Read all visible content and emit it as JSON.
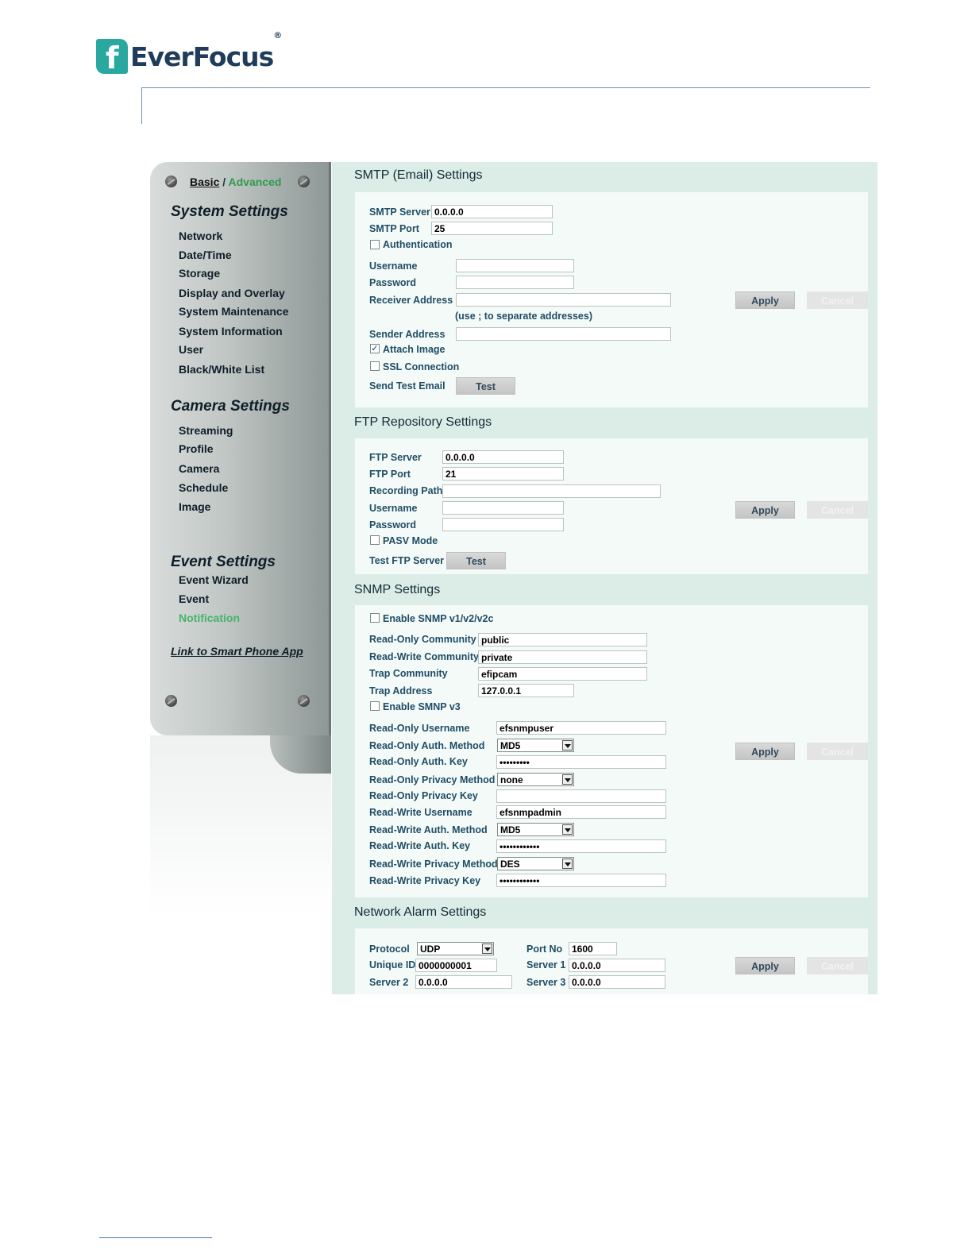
{
  "brand": {
    "name": "EverFocus",
    "reg": "®"
  },
  "sidebar": {
    "mode_basic": "Basic",
    "mode_sep": " / ",
    "mode_advanced": "Advanced",
    "system_title": "System Settings",
    "system_items": [
      "Network",
      "Date/Time",
      "Storage",
      "Display and Overlay",
      "System Maintenance",
      "System Information",
      "User",
      "Black/White List"
    ],
    "camera_title": "Camera Settings",
    "camera_items": [
      "Streaming",
      "Profile",
      "Camera",
      "Schedule",
      "Image"
    ],
    "event_title": "Event Settings",
    "event_items": [
      "Event Wizard",
      "Event",
      "Notification"
    ],
    "smart_link": "Link to Smart Phone App"
  },
  "buttons": {
    "apply": "Apply",
    "cancel": "Cancel",
    "test": "Test"
  },
  "smtp": {
    "title": "SMTP (Email) Settings",
    "server_label": "SMTP Server",
    "server": "0.0.0.0",
    "port_label": "SMTP Port",
    "port": "25",
    "auth_label": "Authentication",
    "auth_checked": false,
    "username_label": "Username",
    "username": "",
    "password_label": "Password",
    "password": "",
    "receiver_label": "Receiver Address",
    "receiver": "",
    "receiver_hint": "(use ; to separate addresses)",
    "sender_label": "Sender Address",
    "sender": "",
    "attach_label": "Attach Image",
    "attach_checked": true,
    "ssl_label": "SSL Connection",
    "ssl_checked": false,
    "test_label": "Send Test Email"
  },
  "ftp": {
    "title": "FTP Repository Settings",
    "server_label": "FTP Server",
    "server": "0.0.0.0",
    "port_label": "FTP Port",
    "port": "21",
    "path_label": "Recording Path",
    "path": "",
    "username_label": "Username",
    "username": "",
    "password_label": "Password",
    "password": "",
    "pasv_label": "PASV Mode",
    "pasv_checked": false,
    "test_label": "Test FTP Server"
  },
  "snmp": {
    "title": "SNMP Settings",
    "enable_v12_label": "Enable SNMP v1/v2/v2c",
    "enable_v12_checked": false,
    "ro_comm_label": "Read-Only Community",
    "ro_comm": "public",
    "rw_comm_label": "Read-Write Community",
    "rw_comm": "private",
    "trap_comm_label": "Trap Community",
    "trap_comm": "efipcam",
    "trap_addr_label": "Trap Address",
    "trap_addr": "127.0.0.1",
    "enable_v3_label": "Enable SMNP v3",
    "enable_v3_checked": false,
    "ro_user_label": "Read-Only Username",
    "ro_user": "efsnmpuser",
    "ro_auth_method_label": "Read-Only Auth. Method",
    "ro_auth_method": "MD5",
    "ro_auth_key_label": "Read-Only Auth. Key",
    "ro_auth_key": "•••••••••",
    "ro_priv_method_label": "Read-Only Privacy Method",
    "ro_priv_method": "none",
    "ro_priv_key_label": "Read-Only Privacy Key",
    "ro_priv_key": "",
    "rw_user_label": "Read-Write Username",
    "rw_user": "efsnmpadmin",
    "rw_auth_method_label": "Read-Write Auth. Method",
    "rw_auth_method": "MD5",
    "rw_auth_key_label": "Read-Write Auth. Key",
    "rw_auth_key": "••••••••••••",
    "rw_priv_method_label": "Read-Write Privacy Method",
    "rw_priv_method": "DES",
    "rw_priv_key_label": "Read-Write Privacy Key",
    "rw_priv_key": "••••••••••••"
  },
  "alarm": {
    "title": "Network Alarm Settings",
    "protocol_label": "Protocol",
    "protocol": "UDP",
    "port_label": "Port No",
    "port": "1600",
    "uid_label": "Unique ID",
    "uid": "0000000001",
    "server1_label": "Server 1",
    "server1": "0.0.0.0",
    "server2_label": "Server 2",
    "server2": "0.0.0.0",
    "server3_label": "Server 3",
    "server3": "0.0.0.0"
  },
  "colors": {
    "brand_teal": "#29a8a0",
    "content_bg": "#dbede6",
    "active_nav": "#45b36b"
  }
}
